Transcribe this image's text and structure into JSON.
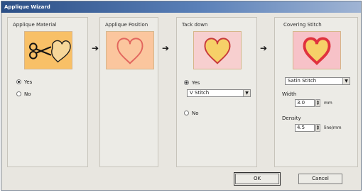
{
  "window": {
    "title": "Applique Wizard"
  },
  "panels": [
    {
      "title": "Applique Material",
      "image_icon": "scissors-heart-icon",
      "radios": [
        {
          "label": "Yes",
          "checked": true
        },
        {
          "label": "No",
          "checked": false
        }
      ]
    },
    {
      "title": "Applique Position",
      "image_icon": "heart-outline-icon"
    },
    {
      "title": "Tack down",
      "image_icon": "tack-down-heart-icon",
      "radios": [
        {
          "label": "Yes",
          "checked": true
        },
        {
          "label": "No",
          "checked": false
        }
      ],
      "stitch_select": "V Stitch"
    },
    {
      "title": "Covering Stitch",
      "image_icon": "covering-heart-icon",
      "stitch_select": "Satin Stitch",
      "width": {
        "label": "Width",
        "value": "3.0",
        "unit": "mm"
      },
      "density": {
        "label": "Density",
        "value": "4.5",
        "unit": "line/mm"
      }
    }
  ],
  "arrows": [
    "arrow-right-icon",
    "arrow-right-icon",
    "arrow-right-icon"
  ],
  "buttons": {
    "ok": "OK",
    "cancel": "Cancel"
  },
  "colors": {
    "material_bg": "#f8c067",
    "position_bg": "#fbc69e",
    "tack_bg": "#f7cfcf",
    "cover_bg": "#f7c2c8",
    "heart_red": "#e0323e",
    "heart_fill": "#f6d068"
  }
}
